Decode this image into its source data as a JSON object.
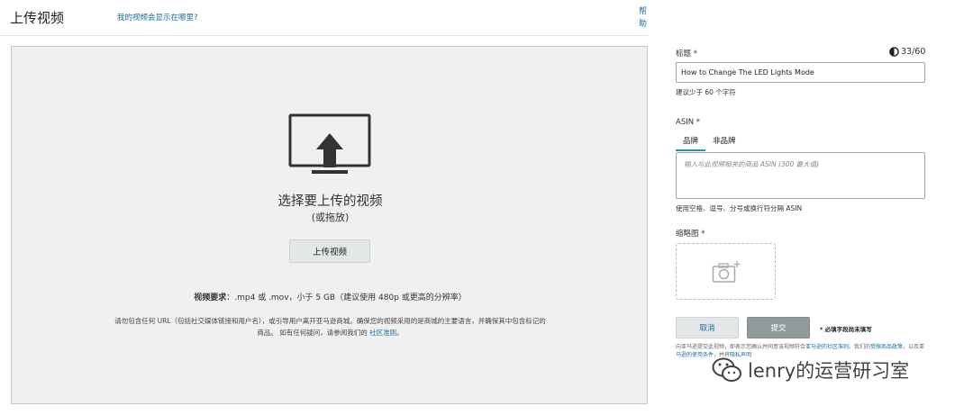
{
  "header": {
    "title": "上传视频",
    "where_link": "我的视频会显示在哪里?",
    "help_link": "帮助"
  },
  "dropzone": {
    "choose_title": "选择要上传的视频",
    "or_drag": "(或拖放)",
    "upload_button": "上传视频",
    "requirements_label": "视频要求",
    "requirements_text": "：.mp4 或 .mov，小于 5 GB（建议使用 480p 或更高的分辨率）",
    "note_line1": "请勿包含任何 URL（包括社交媒体链接和用户名），或引导用户离开亚马逊商城。确保您的视频采用的是商城的主要语言，并确保其中包含标记的",
    "note_line2_prefix": "商品。 如有任何疑问，请参阅我们的 ",
    "note_link": "社区准则",
    "note_suffix": "。"
  },
  "form": {
    "title_label": "标题 *",
    "title_counter": "33/60",
    "title_value": "How to Change The LED Lights Mode",
    "title_hint": "建议少于 60 个字符",
    "asin_label": "ASIN *",
    "tabs": [
      "品牌",
      "非品牌"
    ],
    "asin_placeholder": "输入与此视频相关的商品 ASIN (300 最大值)",
    "asin_hint": "使用空格、逗号、分号或换行符分隔 ASIN",
    "thumbnail_label": "缩略图 *",
    "cancel_button": "取消",
    "submit_button": "提交",
    "required_note": "* 必填字段尚未填写",
    "legal_text_1": "向亚马逊提交此视频，即表示您确认并同意该视频符合",
    "legal_link_1": "亚马逊的社区准则",
    "legal_text_2": "。我们的",
    "legal_link_2": "受限商品政策",
    "legal_text_3": "，以及",
    "legal_link_3": "亚马逊的使用条件",
    "legal_text_4": "，并将",
    "legal_link_4": "隐私声明"
  },
  "watermark": {
    "text": "lenry的运营研习室"
  },
  "colors": {
    "link": "#1a6e9a",
    "dropzone_bg": "#f0f0f0",
    "tab_accent": "#2d8fb5",
    "submit_bg": "#909a9a"
  }
}
